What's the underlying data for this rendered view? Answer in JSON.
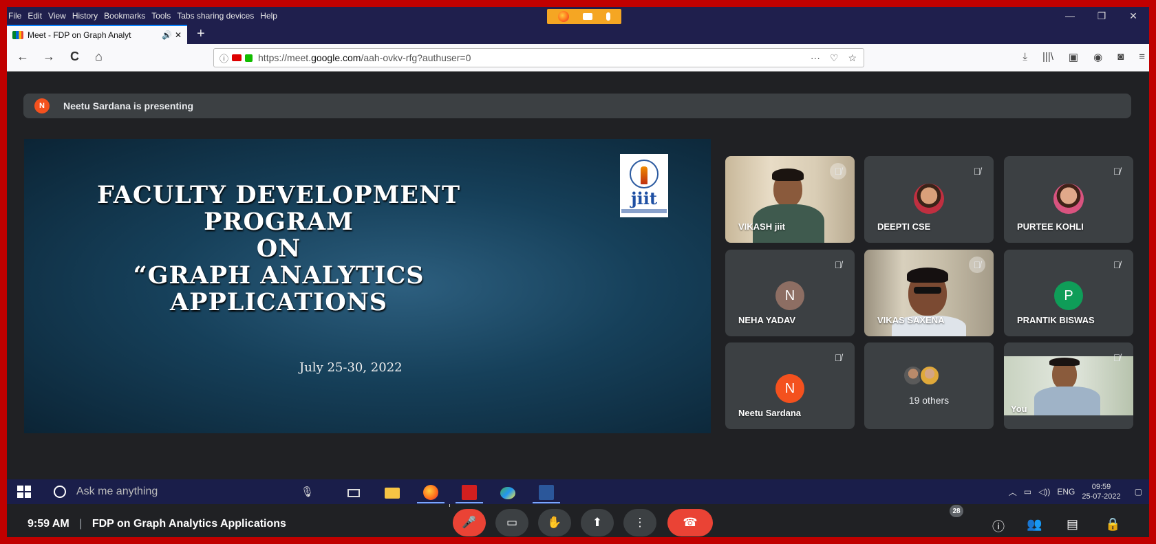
{
  "menubar": {
    "items": [
      "File",
      "Edit",
      "View",
      "History",
      "Bookmarks",
      "Tools",
      "Tabs sharing devices",
      "Help"
    ]
  },
  "window_controls": {
    "minimize": "—",
    "restore": "❐",
    "close": "✕"
  },
  "tab": {
    "title": "Meet - FDP on Graph Analyt",
    "audio_icon": "🔊",
    "close": "✕",
    "new_tab": "+"
  },
  "nav": {
    "back": "←",
    "forward": "→",
    "reload": "C",
    "home": "⌂"
  },
  "url": {
    "prefix": "https://meet.",
    "host": "google.com",
    "path": "/aah-ovkv-rfg?authuser=0",
    "page_actions": "···",
    "pocket": "♡",
    "bookmark": "☆"
  },
  "toolbar_right": [
    "⤓",
    "|||\\",
    "▣",
    "◉",
    "◙",
    "≡"
  ],
  "banner": {
    "avatar": "N",
    "text": "Neetu Sardana is presenting"
  },
  "slide": {
    "title_lines": [
      "FACULTY DEVELOPMENT",
      "PROGRAM",
      "ON",
      "“GRAPH ANALYTICS",
      "APPLICATIONS"
    ],
    "date": "July 25-30, 2022",
    "logo_text": "jiit"
  },
  "participants": [
    {
      "name": "VIKASH jiit",
      "kind": "video"
    },
    {
      "name": "DEEPTI CSE",
      "kind": "photo"
    },
    {
      "name": "PURTEE KOHLI",
      "kind": "photo"
    },
    {
      "name": "NEHA YADAV",
      "kind": "letter",
      "letter": "N",
      "color": "#8d6e63"
    },
    {
      "name": "VIKAS SAXENA",
      "kind": "video"
    },
    {
      "name": "PRANTIK BISWAS",
      "kind": "letter",
      "letter": "P",
      "color": "#0f9d58"
    },
    {
      "name": "Neetu Sardana",
      "kind": "letter",
      "letter": "N",
      "color": "#f4511e"
    },
    {
      "name": "19 others",
      "kind": "others"
    },
    {
      "name": "You",
      "kind": "video"
    }
  ],
  "mute_icon": "🎙̸",
  "bottom": {
    "time": "9:59 AM",
    "separator": "|",
    "meeting_title": "FDP on Graph Analytics Applications",
    "controls": [
      "🎤",
      "▭",
      "✋",
      "⬆",
      "⋮",
      "☎"
    ],
    "people_count": "28",
    "right_icons": [
      "ⓘ",
      "👥",
      "▤",
      "🔒"
    ]
  },
  "taskbar": {
    "search_placeholder": "Ask me anything",
    "lang": "ENG",
    "time": "09:59",
    "date": "25-07-2022"
  },
  "colors": {
    "frame": "#c00000",
    "meet_bg": "#202124",
    "danger": "#ea4335"
  }
}
